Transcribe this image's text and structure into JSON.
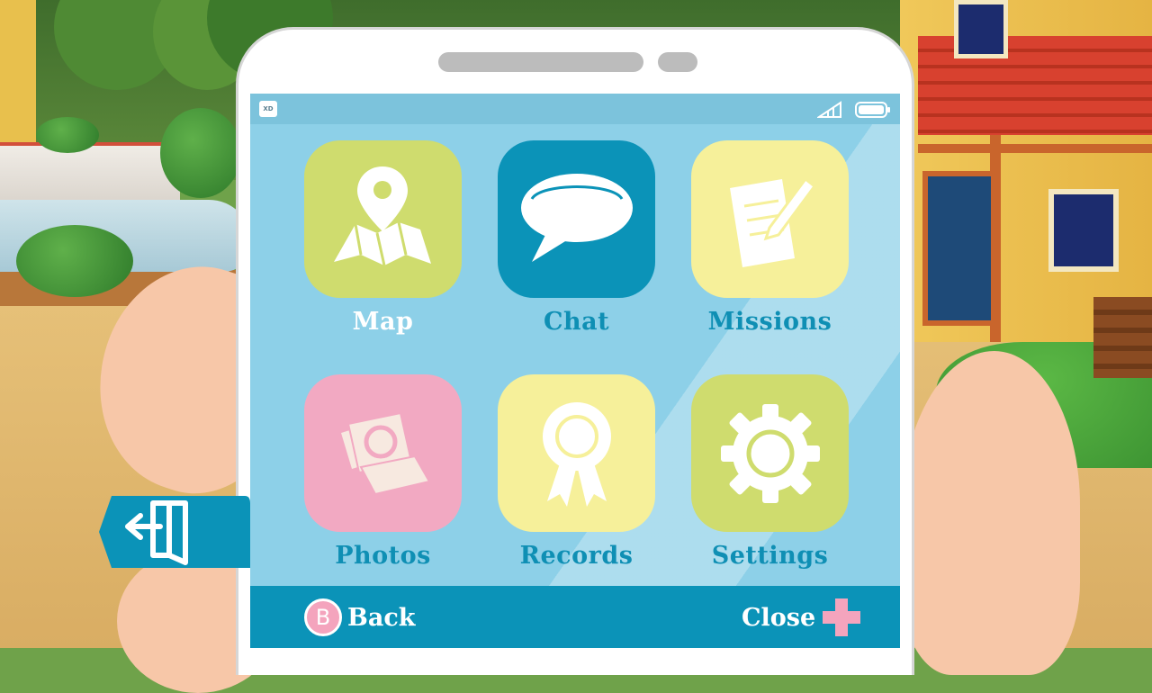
{
  "phone_menu": {
    "apps": [
      {
        "id": "map",
        "label": "Map",
        "icon": "map-pin-icon",
        "tile_color": "#cfdc6e",
        "label_color": "#ffffff"
      },
      {
        "id": "chat",
        "label": "Chat",
        "icon": "speech-bubble-icon",
        "tile_color": "#0b93b8",
        "label_color": "#0f8fb4"
      },
      {
        "id": "missions",
        "label": "Missions",
        "icon": "notepad-pencil-icon",
        "tile_color": "#f6f09a",
        "label_color": "#0f8fb4"
      },
      {
        "id": "photos",
        "label": "Photos",
        "icon": "camera-photos-icon",
        "tile_color": "#f2a9c2",
        "label_color": "#0f8fb4"
      },
      {
        "id": "records",
        "label": "Records",
        "icon": "award-ribbon-icon",
        "tile_color": "#f6f09a",
        "label_color": "#0f8fb4"
      },
      {
        "id": "settings",
        "label": "Settings",
        "icon": "gear-icon",
        "tile_color": "#cfdc6e",
        "label_color": "#0f8fb4"
      }
    ],
    "status_bar": {
      "logo_text": "XD",
      "signal_icon": "signal-icon",
      "battery_icon": "battery-icon"
    },
    "bottom_bar": {
      "back_button_glyph": "B",
      "back_label": "Back",
      "close_label": "Close",
      "close_icon": "plus-icon",
      "bar_color": "#0b93b8"
    }
  },
  "exit_button": {
    "icon": "exit-door-icon",
    "color": "#0b93b8"
  }
}
